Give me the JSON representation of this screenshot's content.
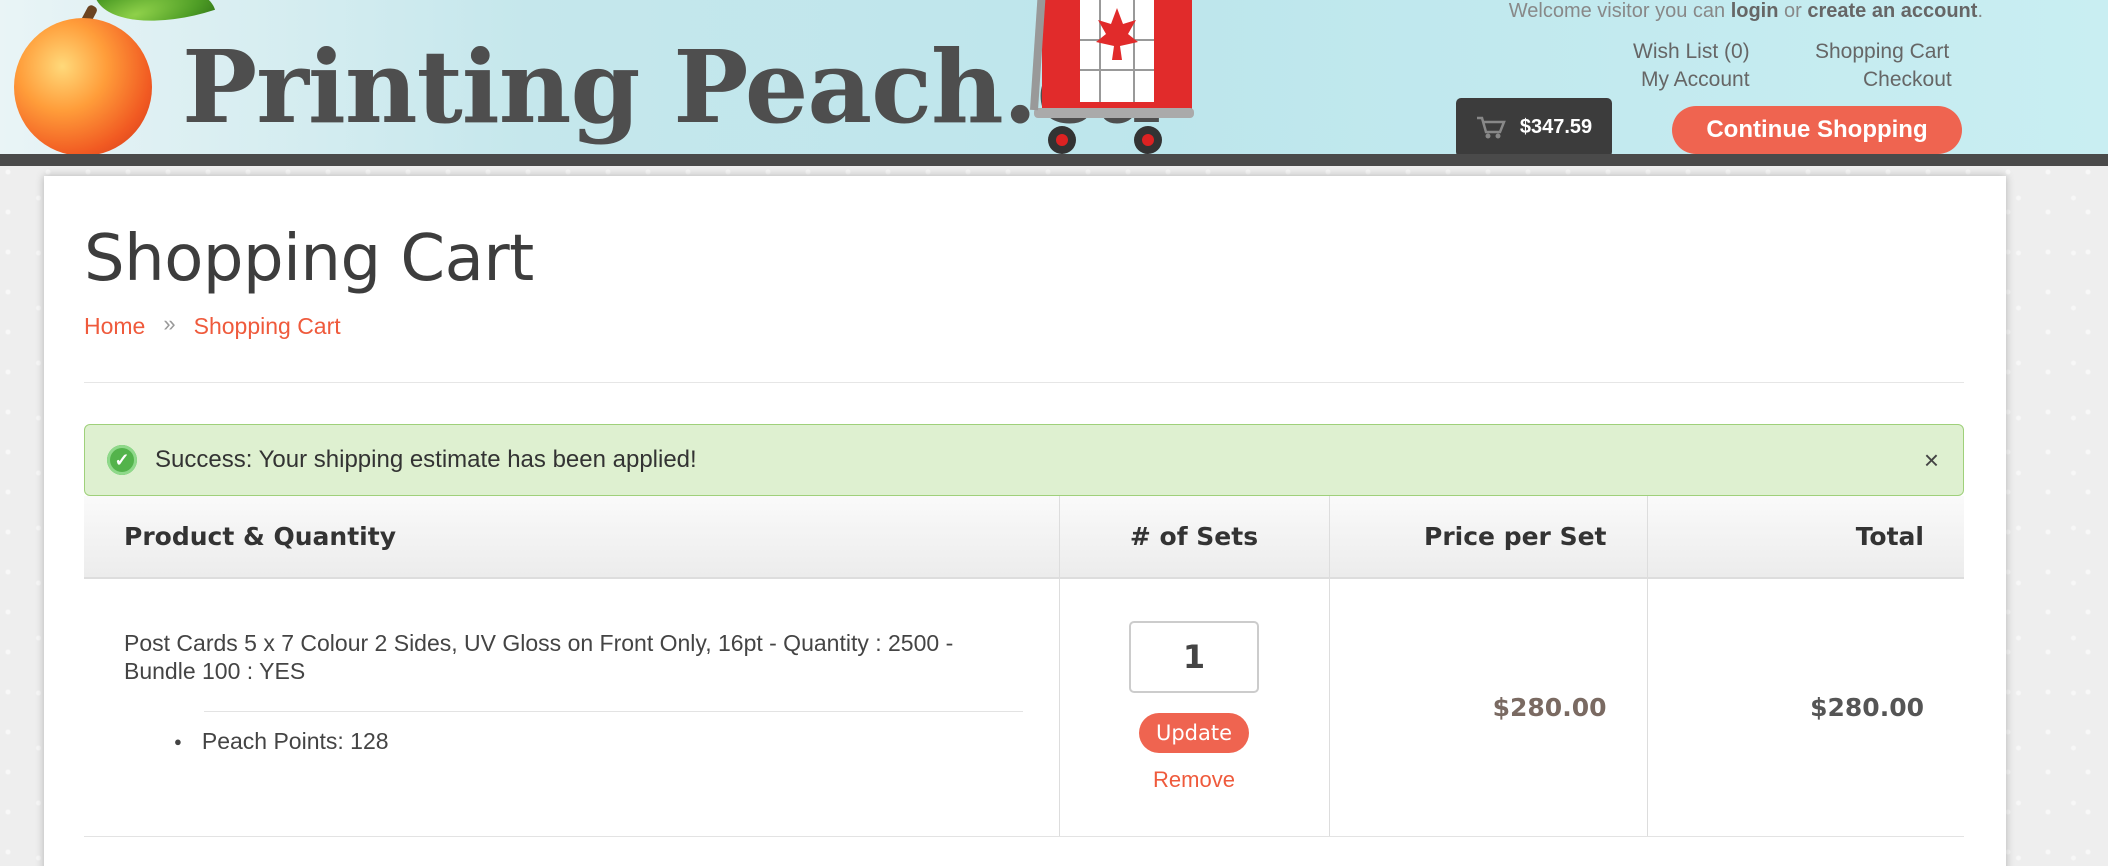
{
  "header": {
    "logo_text": "Printing Peach.ca",
    "welcome_prefix": "Welcome visitor you can ",
    "login_label": "login",
    "welcome_or": " or ",
    "create_account_label": "create an account",
    "welcome_suffix": ".",
    "wishlist_label": "Wish List (0)",
    "shopping_cart_label": "Shopping Cart",
    "my_account_label": "My Account",
    "checkout_label": "Checkout",
    "cart_total": "$347.59",
    "continue_label": "Continue Shopping"
  },
  "page": {
    "title": "Shopping Cart",
    "breadcrumb": [
      "Home",
      "»",
      "Shopping Cart"
    ]
  },
  "alert": {
    "message": "Success: Your shipping estimate has been applied!",
    "close": "×"
  },
  "table": {
    "headers": [
      "Product & Quantity",
      "# of Sets",
      "Price per Set",
      "Total"
    ],
    "rows": [
      {
        "product": "Post Cards 5 x 7 Colour 2 Sides, UV Gloss on Front Only, 16pt - Quantity : 2500 - Bundle 100 : YES",
        "option": "Peach Points: 128",
        "quantity": "1",
        "update_label": "Update",
        "remove_label": "Remove",
        "price": "$280.00",
        "total": "$280.00"
      }
    ]
  },
  "colors": {
    "accent": "#ef6450",
    "alert_bg": "#def0d0",
    "header_bar": "#4a4a4a"
  }
}
